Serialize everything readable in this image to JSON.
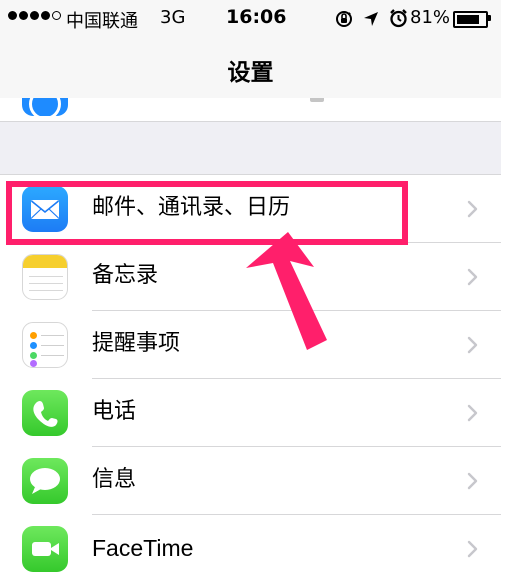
{
  "status_bar": {
    "carrier": "中国联通",
    "network": "3G",
    "time": "16:06",
    "battery_percent": "81%",
    "battery_level": 0.81
  },
  "nav": {
    "title": "设置"
  },
  "settings": [
    {
      "label": "邮件、通讯录、日历",
      "icon": "mail-icon"
    },
    {
      "label": "备忘录",
      "icon": "notes-icon"
    },
    {
      "label": "提醒事项",
      "icon": "reminders-icon"
    },
    {
      "label": "电话",
      "icon": "phone-icon"
    },
    {
      "label": "信息",
      "icon": "messages-icon"
    },
    {
      "label": "FaceTime",
      "icon": "facetime-icon"
    }
  ],
  "colors": {
    "highlight": "#ff1f6b",
    "separator": "#d7d7d9",
    "group_background": "#efeff4",
    "green_icon": "#35c92c",
    "blue_icon": "#1d7cf5"
  }
}
